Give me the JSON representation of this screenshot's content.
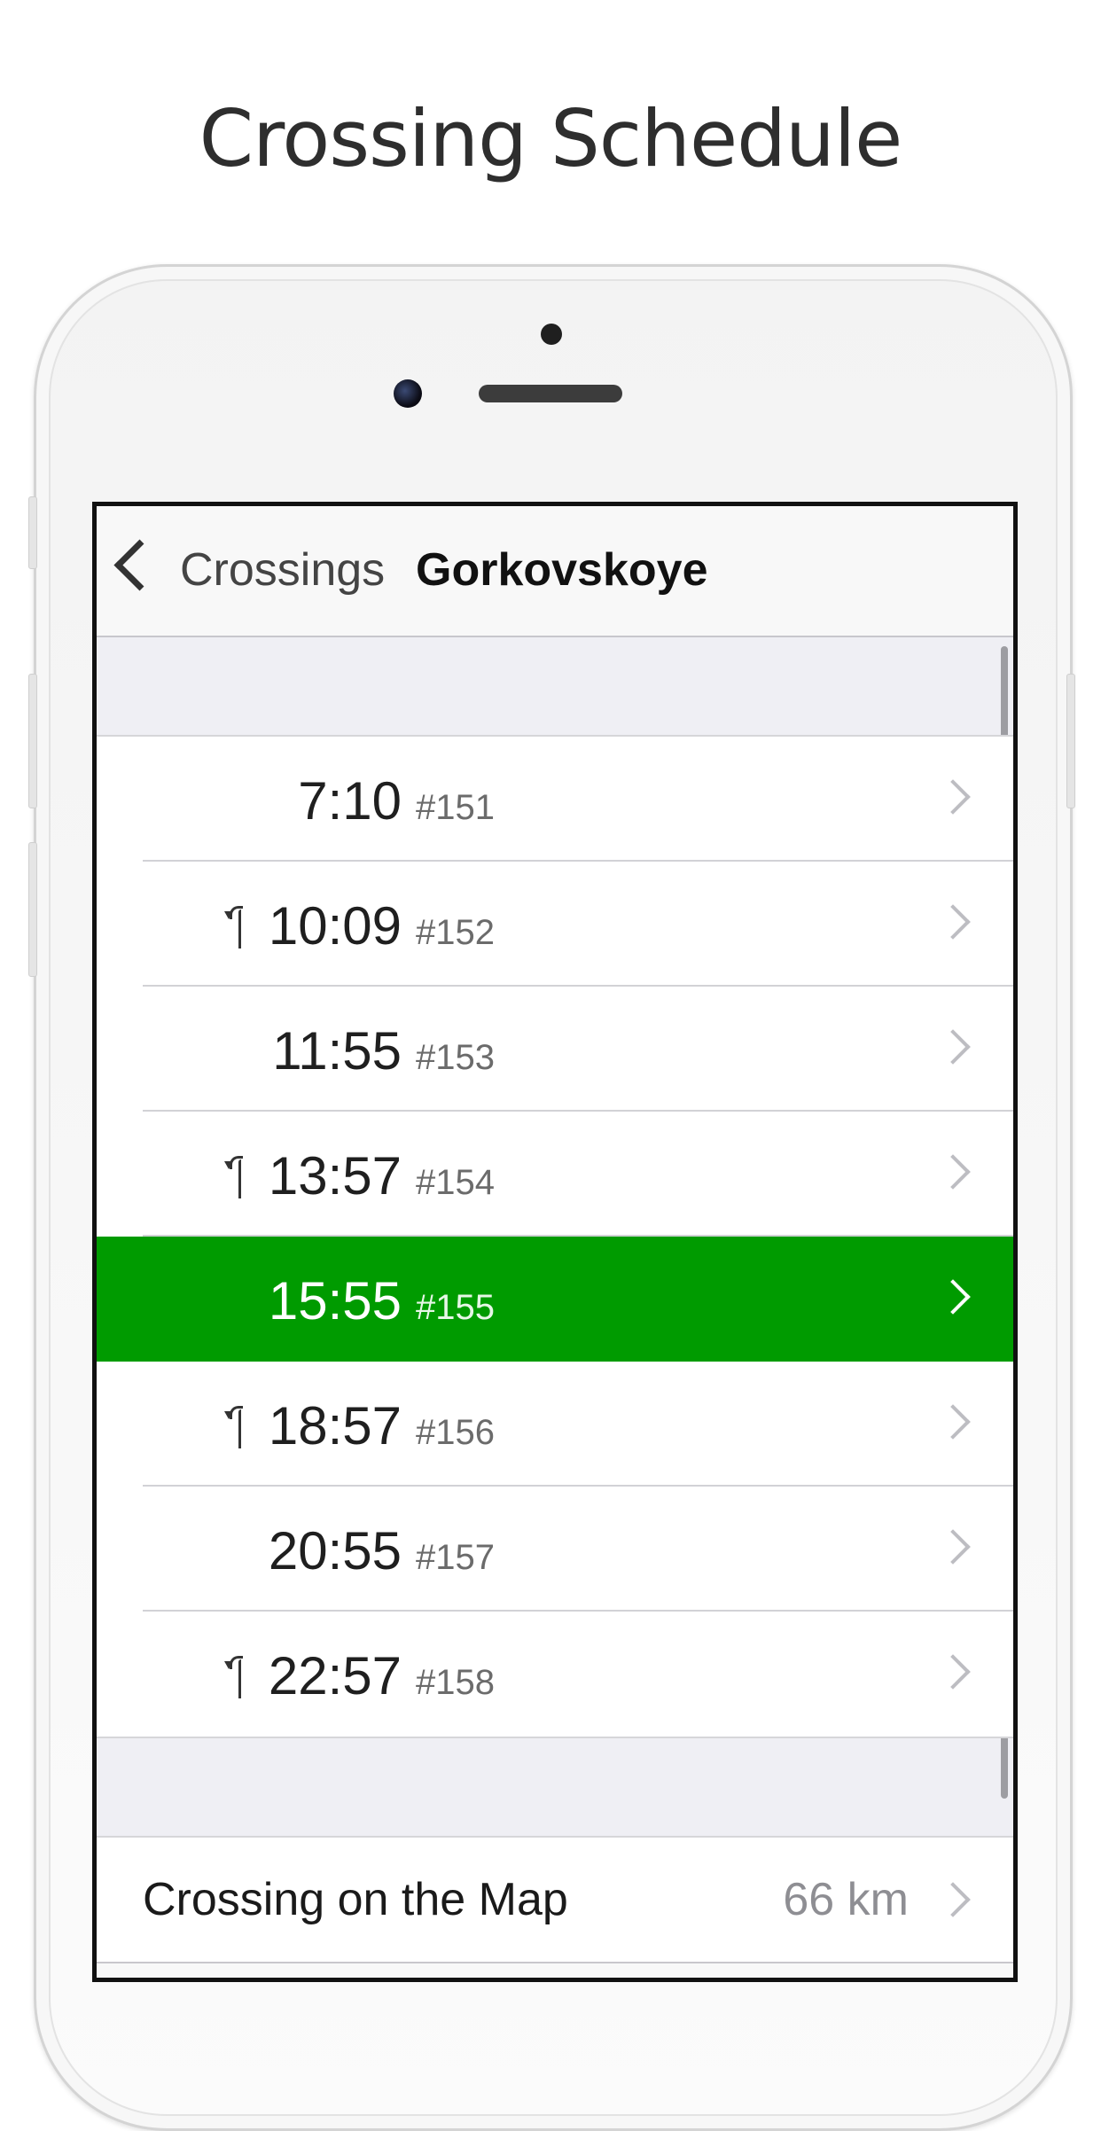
{
  "headline": "Crossing Schedule",
  "navbar": {
    "back_label": "Crossings",
    "title": "Gorkovskoye"
  },
  "schedule": [
    {
      "time": "7:10",
      "trip": "#151",
      "return_icon": false,
      "selected": false
    },
    {
      "time": "10:09",
      "trip": "#152",
      "return_icon": true,
      "selected": false
    },
    {
      "time": "11:55",
      "trip": "#153",
      "return_icon": false,
      "selected": false
    },
    {
      "time": "13:57",
      "trip": "#154",
      "return_icon": true,
      "selected": false
    },
    {
      "time": "15:55",
      "trip": "#155",
      "return_icon": false,
      "selected": true
    },
    {
      "time": "18:57",
      "trip": "#156",
      "return_icon": true,
      "selected": false
    },
    {
      "time": "20:55",
      "trip": "#157",
      "return_icon": false,
      "selected": false
    },
    {
      "time": "22:57",
      "trip": "#158",
      "return_icon": true,
      "selected": false
    }
  ],
  "map_row": {
    "label": "Crossing on the Map",
    "distance": "66 km"
  },
  "colors": {
    "selected_row": "#009b00",
    "accent_text": "#1f1f1f"
  },
  "icons": {
    "back": "chevron-left-icon",
    "row": "chevron-right-icon",
    "return": "return-arrow-icon"
  }
}
